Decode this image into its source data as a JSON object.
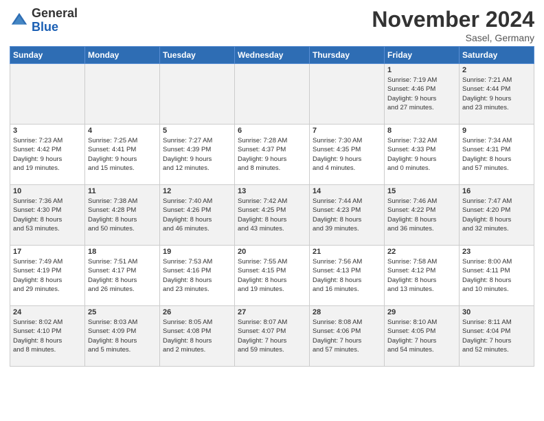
{
  "header": {
    "logo_general": "General",
    "logo_blue": "Blue",
    "month_title": "November 2024",
    "location": "Sasel, Germany"
  },
  "weekdays": [
    "Sunday",
    "Monday",
    "Tuesday",
    "Wednesday",
    "Thursday",
    "Friday",
    "Saturday"
  ],
  "weeks": [
    [
      {
        "day": "",
        "info": ""
      },
      {
        "day": "",
        "info": ""
      },
      {
        "day": "",
        "info": ""
      },
      {
        "day": "",
        "info": ""
      },
      {
        "day": "",
        "info": ""
      },
      {
        "day": "1",
        "info": "Sunrise: 7:19 AM\nSunset: 4:46 PM\nDaylight: 9 hours\nand 27 minutes."
      },
      {
        "day": "2",
        "info": "Sunrise: 7:21 AM\nSunset: 4:44 PM\nDaylight: 9 hours\nand 23 minutes."
      }
    ],
    [
      {
        "day": "3",
        "info": "Sunrise: 7:23 AM\nSunset: 4:42 PM\nDaylight: 9 hours\nand 19 minutes."
      },
      {
        "day": "4",
        "info": "Sunrise: 7:25 AM\nSunset: 4:41 PM\nDaylight: 9 hours\nand 15 minutes."
      },
      {
        "day": "5",
        "info": "Sunrise: 7:27 AM\nSunset: 4:39 PM\nDaylight: 9 hours\nand 12 minutes."
      },
      {
        "day": "6",
        "info": "Sunrise: 7:28 AM\nSunset: 4:37 PM\nDaylight: 9 hours\nand 8 minutes."
      },
      {
        "day": "7",
        "info": "Sunrise: 7:30 AM\nSunset: 4:35 PM\nDaylight: 9 hours\nand 4 minutes."
      },
      {
        "day": "8",
        "info": "Sunrise: 7:32 AM\nSunset: 4:33 PM\nDaylight: 9 hours\nand 0 minutes."
      },
      {
        "day": "9",
        "info": "Sunrise: 7:34 AM\nSunset: 4:31 PM\nDaylight: 8 hours\nand 57 minutes."
      }
    ],
    [
      {
        "day": "10",
        "info": "Sunrise: 7:36 AM\nSunset: 4:30 PM\nDaylight: 8 hours\nand 53 minutes."
      },
      {
        "day": "11",
        "info": "Sunrise: 7:38 AM\nSunset: 4:28 PM\nDaylight: 8 hours\nand 50 minutes."
      },
      {
        "day": "12",
        "info": "Sunrise: 7:40 AM\nSunset: 4:26 PM\nDaylight: 8 hours\nand 46 minutes."
      },
      {
        "day": "13",
        "info": "Sunrise: 7:42 AM\nSunset: 4:25 PM\nDaylight: 8 hours\nand 43 minutes."
      },
      {
        "day": "14",
        "info": "Sunrise: 7:44 AM\nSunset: 4:23 PM\nDaylight: 8 hours\nand 39 minutes."
      },
      {
        "day": "15",
        "info": "Sunrise: 7:46 AM\nSunset: 4:22 PM\nDaylight: 8 hours\nand 36 minutes."
      },
      {
        "day": "16",
        "info": "Sunrise: 7:47 AM\nSunset: 4:20 PM\nDaylight: 8 hours\nand 32 minutes."
      }
    ],
    [
      {
        "day": "17",
        "info": "Sunrise: 7:49 AM\nSunset: 4:19 PM\nDaylight: 8 hours\nand 29 minutes."
      },
      {
        "day": "18",
        "info": "Sunrise: 7:51 AM\nSunset: 4:17 PM\nDaylight: 8 hours\nand 26 minutes."
      },
      {
        "day": "19",
        "info": "Sunrise: 7:53 AM\nSunset: 4:16 PM\nDaylight: 8 hours\nand 23 minutes."
      },
      {
        "day": "20",
        "info": "Sunrise: 7:55 AM\nSunset: 4:15 PM\nDaylight: 8 hours\nand 19 minutes."
      },
      {
        "day": "21",
        "info": "Sunrise: 7:56 AM\nSunset: 4:13 PM\nDaylight: 8 hours\nand 16 minutes."
      },
      {
        "day": "22",
        "info": "Sunrise: 7:58 AM\nSunset: 4:12 PM\nDaylight: 8 hours\nand 13 minutes."
      },
      {
        "day": "23",
        "info": "Sunrise: 8:00 AM\nSunset: 4:11 PM\nDaylight: 8 hours\nand 10 minutes."
      }
    ],
    [
      {
        "day": "24",
        "info": "Sunrise: 8:02 AM\nSunset: 4:10 PM\nDaylight: 8 hours\nand 8 minutes."
      },
      {
        "day": "25",
        "info": "Sunrise: 8:03 AM\nSunset: 4:09 PM\nDaylight: 8 hours\nand 5 minutes."
      },
      {
        "day": "26",
        "info": "Sunrise: 8:05 AM\nSunset: 4:08 PM\nDaylight: 8 hours\nand 2 minutes."
      },
      {
        "day": "27",
        "info": "Sunrise: 8:07 AM\nSunset: 4:07 PM\nDaylight: 7 hours\nand 59 minutes."
      },
      {
        "day": "28",
        "info": "Sunrise: 8:08 AM\nSunset: 4:06 PM\nDaylight: 7 hours\nand 57 minutes."
      },
      {
        "day": "29",
        "info": "Sunrise: 8:10 AM\nSunset: 4:05 PM\nDaylight: 7 hours\nand 54 minutes."
      },
      {
        "day": "30",
        "info": "Sunrise: 8:11 AM\nSunset: 4:04 PM\nDaylight: 7 hours\nand 52 minutes."
      }
    ]
  ]
}
